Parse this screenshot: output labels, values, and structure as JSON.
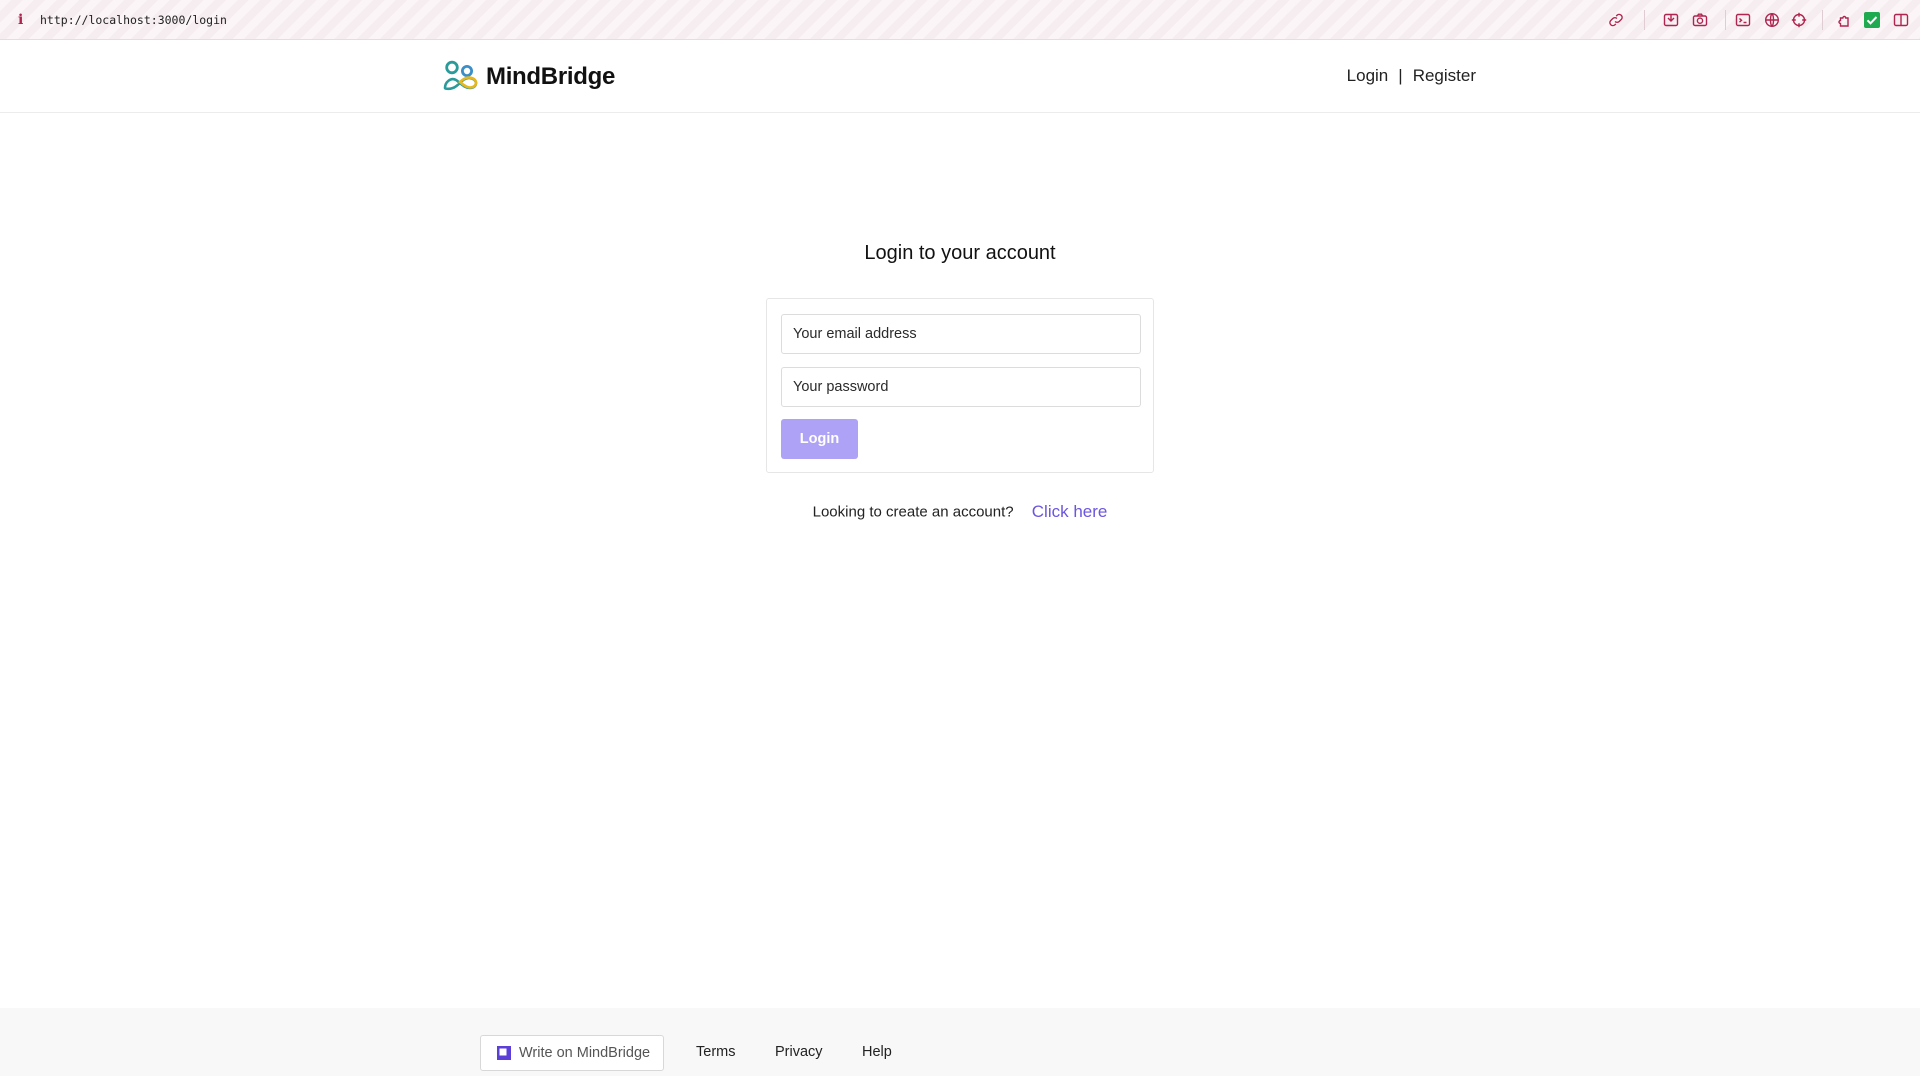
{
  "browser": {
    "url": "http://localhost:3000/login",
    "icons": [
      "link-icon",
      "inbox-icon",
      "camera-icon",
      "terminal-icon",
      "globe-icon",
      "crosshair-icon",
      "puzzle-icon",
      "check-icon",
      "split-view-icon"
    ],
    "accent_color": "#b0254f"
  },
  "header": {
    "brand": "MindBridge",
    "nav": {
      "login": "Login",
      "separator": "|",
      "register": "Register"
    }
  },
  "main": {
    "title": "Login to your account",
    "email_placeholder": "Your email address",
    "password_placeholder": "Your password",
    "login_button": "Login",
    "create_prompt": "Looking to create an account?",
    "create_link": "Click here"
  },
  "footer": {
    "write_button": "Write on MindBridge",
    "links": [
      "Terms",
      "Privacy",
      "Help"
    ]
  },
  "colors": {
    "brand_button": "#aea2f6",
    "link": "#6c55e0",
    "footer_bg": "#f8f8f8"
  }
}
